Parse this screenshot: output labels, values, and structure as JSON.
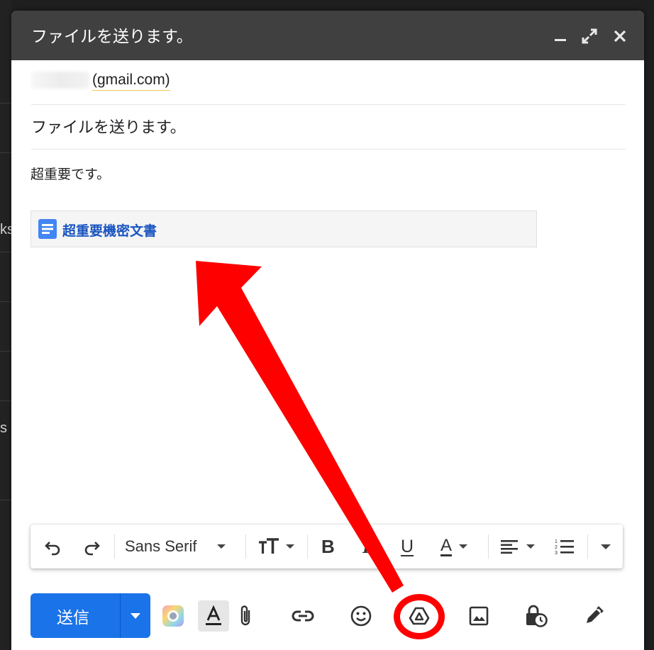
{
  "header": {
    "title": "ファイルを送ります。"
  },
  "recipient": {
    "domain": "(gmail.com)"
  },
  "subject": {
    "value": "ファイルを送ります。"
  },
  "body": {
    "text": "超重要です。"
  },
  "attachment": {
    "name": "超重要機密文書",
    "icon": "google-docs-icon"
  },
  "format_toolbar": {
    "font": "Sans Serif",
    "bold_label": "B",
    "italic_label": "I",
    "underline_label": "U",
    "text_color_label": "A"
  },
  "send": {
    "label": "送信"
  },
  "background": {
    "fragment_1": "ks",
    "fragment_2": "s"
  },
  "colors": {
    "header_bg": "#404040",
    "send_blue": "#1a73e8",
    "link_blue": "#1a55c0",
    "annotation_red": "#ff0000"
  }
}
